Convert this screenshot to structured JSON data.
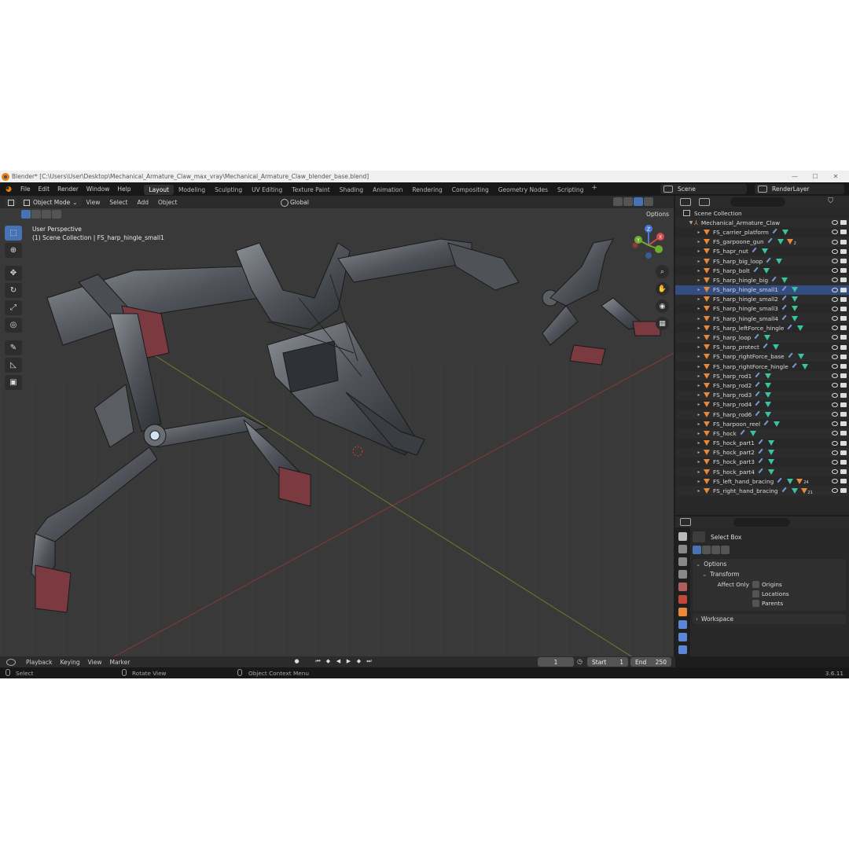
{
  "window": {
    "title": "Blender* [C:\\Users\\User\\Desktop\\Mechanical_Armature_Claw_max_vray\\Mechanical_Armature_Claw_blender_base.blend]",
    "minimize": "—",
    "maximize": "☐",
    "close": "✕"
  },
  "menubar": {
    "items": [
      "File",
      "Edit",
      "Render",
      "Window",
      "Help"
    ]
  },
  "workspaces": [
    "Layout",
    "Modeling",
    "Sculpting",
    "UV Editing",
    "Texture Paint",
    "Shading",
    "Animation",
    "Rendering",
    "Compositing",
    "Geometry Nodes",
    "Scripting"
  ],
  "active_workspace": "Layout",
  "scene": "Scene",
  "render_layer": "RenderLayer",
  "viewport": {
    "mode": "Object Mode",
    "menus": [
      "View",
      "Select",
      "Add",
      "Object"
    ],
    "orientation": "Global",
    "options_label": "Options",
    "info_line1": "User Perspective",
    "info_line2": "(1) Scene Collection | FS_harp_hingle_small1",
    "gizmo": {
      "z": "Z",
      "y": "Y",
      "x": "X"
    }
  },
  "outliner": {
    "root": "Scene Collection",
    "collection": "Mechanical_Armature_Claw",
    "items": [
      {
        "name": "FS_carrier_platform"
      },
      {
        "name": "FS_garpoone_gun",
        "badge": "2"
      },
      {
        "name": "FS_hapr_nut"
      },
      {
        "name": "FS_harp_big_loop"
      },
      {
        "name": "FS_harp_bolt"
      },
      {
        "name": "FS_harp_hingle_big"
      },
      {
        "name": "FS_harp_hingle_small1"
      },
      {
        "name": "FS_harp_hingle_small2"
      },
      {
        "name": "FS_harp_hingle_small3"
      },
      {
        "name": "FS_harp_hingle_small4"
      },
      {
        "name": "FS_harp_leftForce_hingle"
      },
      {
        "name": "FS_harp_loop"
      },
      {
        "name": "FS_harp_protect"
      },
      {
        "name": "FS_harp_rightForce_base"
      },
      {
        "name": "FS_harp_rightForce_hingle"
      },
      {
        "name": "FS_harp_rod1"
      },
      {
        "name": "FS_harp_rod2"
      },
      {
        "name": "FS_harp_rod3"
      },
      {
        "name": "FS_harp_rod4"
      },
      {
        "name": "FS_harp_rod6"
      },
      {
        "name": "FS_harpoon_reel"
      },
      {
        "name": "FS_hock"
      },
      {
        "name": "FS_hock_part1"
      },
      {
        "name": "FS_hock_part2"
      },
      {
        "name": "FS_hock_part3"
      },
      {
        "name": "FS_hock_part4"
      },
      {
        "name": "FS_left_hand_bracing",
        "badge": "24"
      },
      {
        "name": "FS_right_hand_bracing",
        "badge": "21"
      }
    ]
  },
  "properties": {
    "tool_name": "Select Box",
    "options": "Options",
    "transform": "Transform",
    "affect_only": "Affect Only",
    "origins": "Origins",
    "locations": "Locations",
    "parents": "Parents",
    "workspace": "Workspace"
  },
  "timeline": {
    "menus": [
      "Playback",
      "Keying",
      "View",
      "Marker"
    ],
    "current_frame": "1",
    "start_label": "Start",
    "start": "1",
    "end_label": "End",
    "end": "250"
  },
  "status": {
    "select": "Select",
    "rotate": "Rotate View",
    "context": "Object Context Menu",
    "version": "3.6.11"
  }
}
